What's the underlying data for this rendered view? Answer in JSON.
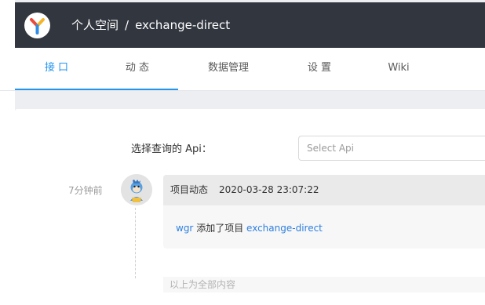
{
  "header": {
    "space": "个人空间",
    "separator": "/",
    "project": "exchange-direct"
  },
  "tabs": [
    {
      "label": "接 口",
      "active": true
    },
    {
      "label": "动 态",
      "active": false
    },
    {
      "label": "数据管理",
      "active": false
    },
    {
      "label": "设 置",
      "active": false
    },
    {
      "label": "Wiki",
      "active": false
    }
  ],
  "filter": {
    "label": "选择查询的 Api：",
    "placeholder": "Select Api"
  },
  "timeline": {
    "items": [
      {
        "time_ago": "7分钟前",
        "title": "项目动态",
        "timestamp": "2020-03-28 23:07:22",
        "user": "wgr",
        "action": " 添加了项目 ",
        "target": "exchange-direct"
      }
    ],
    "end_note": "以上为全部内容"
  },
  "colors": {
    "header_bg": "#32363f",
    "accent": "#2395f1",
    "link": "#2d7fe0",
    "page_bg": "#eceef1"
  },
  "icons": {
    "logo": "yapi-logo-icon",
    "avatar": "user-avatar"
  }
}
